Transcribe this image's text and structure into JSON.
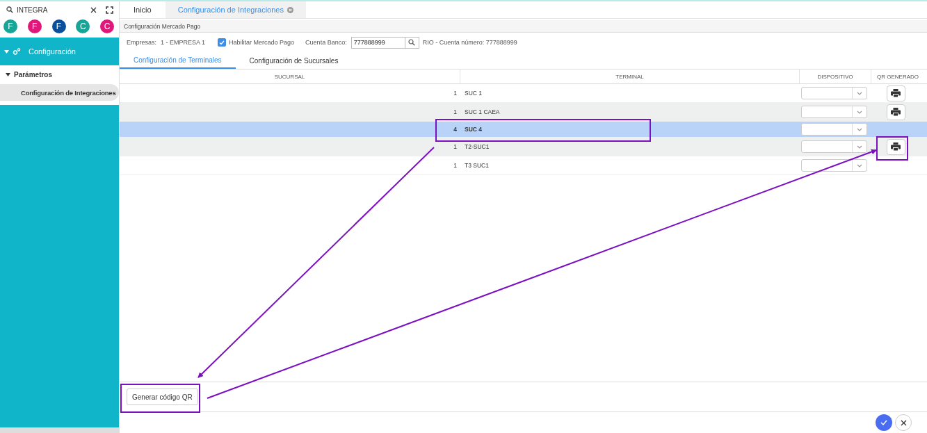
{
  "sidebar": {
    "search": {
      "value": "INTEGRA"
    },
    "avatars": [
      {
        "letter": "F",
        "color": "#16a596"
      },
      {
        "letter": "F",
        "color": "#e0187a"
      },
      {
        "letter": "F",
        "color": "#0b4f9c"
      },
      {
        "letter": "C",
        "color": "#16a596"
      },
      {
        "letter": "C",
        "color": "#e0187a"
      }
    ],
    "menu": [
      {
        "label": "Configuración",
        "expanded": true,
        "children": [
          {
            "label": "Parámetros",
            "expanded": true,
            "children": [
              {
                "label": "Configuración de Integraciones",
                "selected": true
              }
            ]
          }
        ]
      }
    ]
  },
  "tabs": [
    {
      "label": "Inicio",
      "selected": false,
      "closable": false
    },
    {
      "label": "Configuración de Integraciones",
      "selected": true,
      "closable": true
    }
  ],
  "breadcrumb": "Configuración Mercado Pago",
  "filters": {
    "empresas_label": "Empresas:",
    "empresas_value": "1 - EMPRESA 1",
    "enable": {
      "label": "Habilitar Mercado Pago",
      "checked": true
    },
    "cuenta_label": "Cuenta Banco:",
    "cuenta_value": "777888999",
    "cuenta_info": "RIO - Cuenta número: 777888999"
  },
  "subtabs": [
    {
      "label": "Configuración de Terminales",
      "selected": true
    },
    {
      "label": "Configuración de Sucursales",
      "selected": false
    }
  ],
  "table": {
    "columns": [
      "SUCURSAL",
      "TERMINAL",
      "DISPOSITIVO",
      "QR GENERADO"
    ],
    "rows": [
      {
        "number": "1",
        "terminal": "SUC 1",
        "selected": false,
        "qr": true
      },
      {
        "number": "1",
        "terminal": "SUC 1 CAEA",
        "selected": false,
        "qr": true
      },
      {
        "number": "4",
        "terminal": "SUC 4",
        "selected": true,
        "qr": false
      },
      {
        "number": "1",
        "terminal": "T2-SUC1",
        "selected": false,
        "qr": true
      },
      {
        "number": "1",
        "terminal": "T3 SUC1",
        "selected": false,
        "qr": false
      }
    ]
  },
  "generate_button": "Generar código QR"
}
